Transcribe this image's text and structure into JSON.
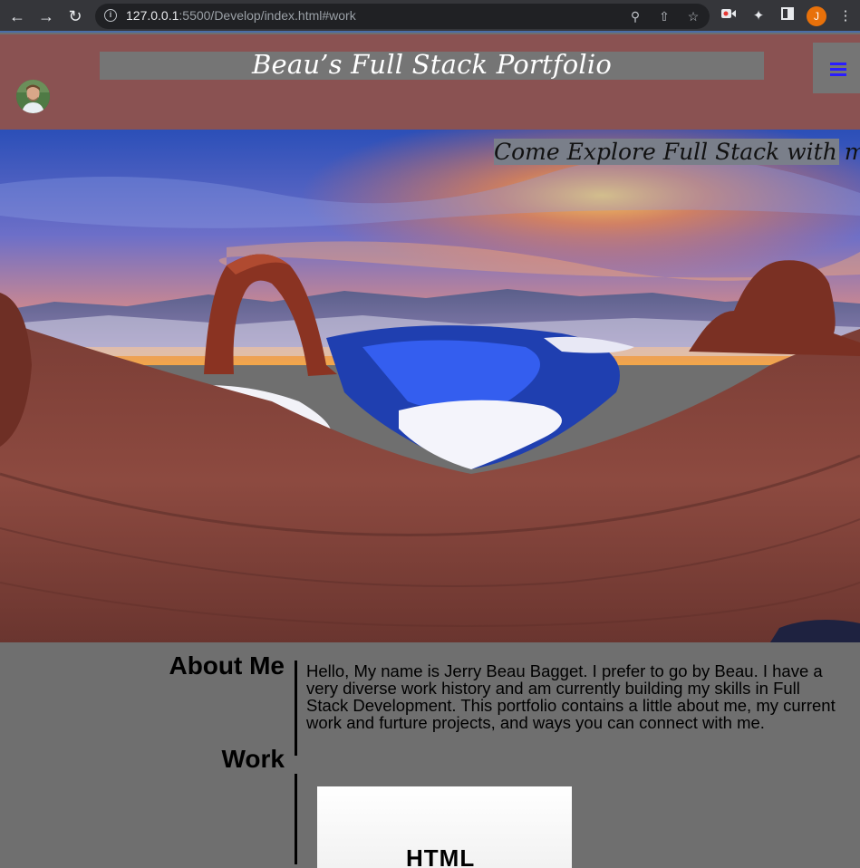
{
  "browser": {
    "back_icon": "arrow-left-icon",
    "forward_icon": "arrow-right-icon",
    "reload_icon": "reload-icon",
    "url_host": "127.0.0.1",
    "url_rest": ":5500/Develop/index.html#work",
    "profile_initial": "J"
  },
  "header": {
    "title": "Beau’s Full Stack Portfolio",
    "menu_icon": "hamburger-menu-icon"
  },
  "hero": {
    "tagline": "Come Explore Full Stack with me!"
  },
  "about": {
    "heading": "About Me",
    "text": "Hello, My name is Jerry Beau Bagget. I prefer to go by Beau. I have a very diverse work history and am currently building my skills in Full Stack Development. This portfolio contains a little about me, my current work and furture projects, and ways you can connect with me."
  },
  "work": {
    "heading": "Work",
    "card_label": "HTML"
  },
  "colors": {
    "header_bg": "#8a5252",
    "content_bg": "#6f6f6f",
    "menu_icon": "#2a1cff"
  }
}
